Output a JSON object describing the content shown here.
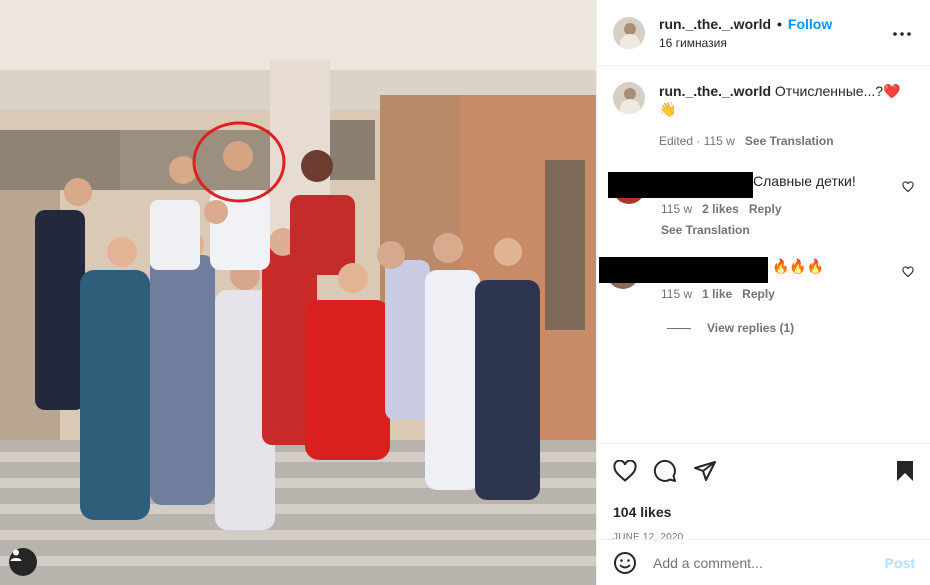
{
  "post": {
    "username": "run._.the._.world",
    "follow_label": "Follow",
    "location": "16 гимназия",
    "more_icon": "more-horizontal-icon",
    "caption_user": "run._.the._.world",
    "caption_text": "Отчисленные...?❤️👋",
    "caption_edited": "Edited",
    "caption_age": "115 w",
    "caption_translate": "See Translation",
    "likes": "104 likes",
    "date": "JUNE 12, 2020"
  },
  "comments": [
    {
      "text": "Славные детки!",
      "age": "115 w",
      "likes": "2 likes",
      "reply": "Reply",
      "translate": "See Translation"
    },
    {
      "text": "🔥🔥🔥",
      "age": "115 w",
      "likes": "1 like",
      "reply": "Reply"
    }
  ],
  "view_replies": "View replies (1)",
  "composer": {
    "placeholder": "Add a comment...",
    "post_label": "Post"
  },
  "colors": {
    "link": "#0095f6",
    "muted": "#737373",
    "post_disabled": "#b2dffc",
    "annotation": "#e02020"
  }
}
